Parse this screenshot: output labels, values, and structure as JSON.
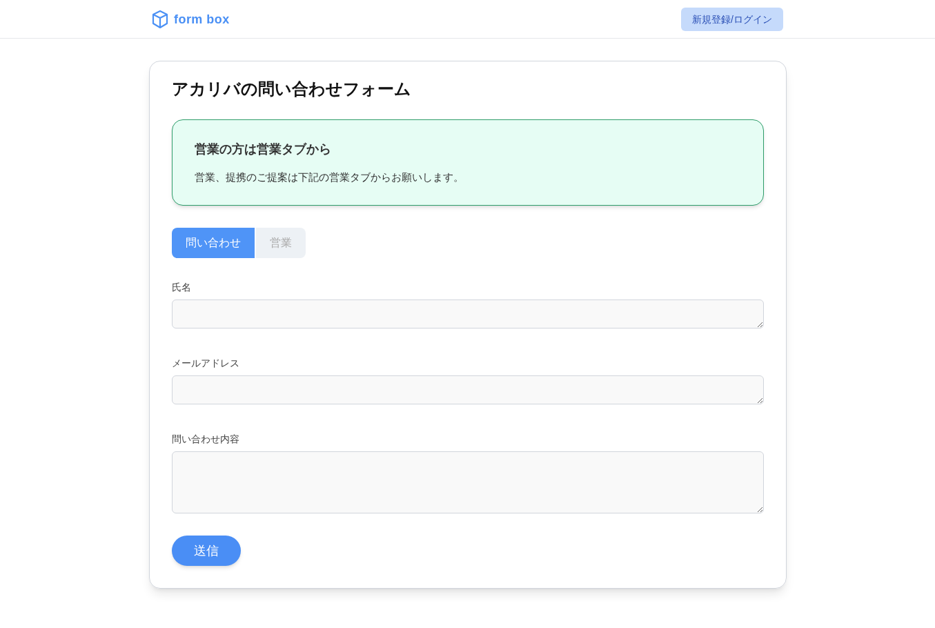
{
  "header": {
    "logo": "form box",
    "login_button": "新規登録/ログイン"
  },
  "form": {
    "title": "アカリバの問い合わせフォーム",
    "notice": {
      "heading": "営業の方は営業タブから",
      "body": "営業、提携のご提案は下記の営業タブからお願いします。"
    },
    "tabs": [
      {
        "label": "問い合わせ",
        "selected": true
      },
      {
        "label": "営業",
        "selected": false
      }
    ],
    "fields": [
      {
        "label": "氏名",
        "kind": "line"
      },
      {
        "label": "メールアドレス",
        "kind": "line"
      },
      {
        "label": "問い合わせ内容",
        "kind": "area"
      }
    ],
    "submit": "送信"
  }
}
